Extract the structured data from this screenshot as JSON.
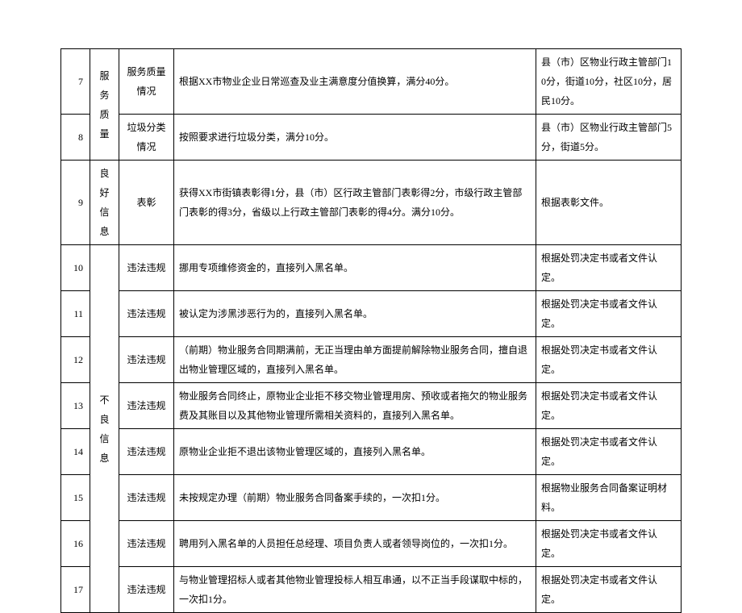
{
  "rows": [
    {
      "idx": "7",
      "cat": "服务质量",
      "item_l1": "服务质量",
      "item_l2": "情况",
      "desc": "根据XX市物业企业日常巡查及业主满意度分值换算，满分40分。",
      "note": "县（市）区物业行政主管部门10分，街道10分，社区10分，居民10分。"
    },
    {
      "idx": "8",
      "cat": "",
      "item_l1": "垃圾分类",
      "item_l2": "情况",
      "desc": "按照要求进行垃圾分类，满分10分。",
      "note": "县（市）区物业行政主管部门5分，街道5分。"
    },
    {
      "idx": "9",
      "cat": "良好信息",
      "item_l1": "表彰",
      "item_l2": "",
      "desc": "获得XX市街镇表彰得1分，县（市）区行政主管部门表彰得2分，市级行政主管部门表彰的得3分，省级以上行政主管部门表彰的得4分。满分10分。",
      "note": "根据表彰文件。"
    },
    {
      "idx": "10",
      "cat": "不良信息",
      "item_l1": "违法违规",
      "item_l2": "",
      "desc": "挪用专项维修资金的，直接列入黑名单。",
      "note": "根据处罚决定书或者文件认定。"
    },
    {
      "idx": "11",
      "cat": "",
      "item_l1": "违法违规",
      "item_l2": "",
      "desc": "被认定为涉黑涉恶行为的，直接列入黑名单。",
      "note": "根据处罚决定书或者文件认定。"
    },
    {
      "idx": "12",
      "cat": "",
      "item_l1": "违法违规",
      "item_l2": "",
      "desc": "（前期）物业服务合同期满前，无正当理由单方面提前解除物业服务合同，擅自退出物业管理区域的，直接列入黑名单。",
      "note": "根据处罚决定书或者文件认定。"
    },
    {
      "idx": "13",
      "cat": "",
      "item_l1": "违法违规",
      "item_l2": "",
      "desc": "物业服务合同终止，原物业企业拒不移交物业管理用房、预收或者拖欠的物业服务费及其账目以及其他物业管理所需相关资料的，直接列入黑名单。",
      "note": "根据处罚决定书或者文件认定。"
    },
    {
      "idx": "14",
      "cat": "",
      "item_l1": "违法违规",
      "item_l2": "",
      "desc": "原物业企业拒不退出该物业管理区域的，直接列入黑名单。",
      "note": "根据处罚决定书或者文件认定。"
    },
    {
      "idx": "15",
      "cat": "",
      "item_l1": "违法违规",
      "item_l2": "",
      "desc": "未按规定办理（前期）物业服务合同备案手续的，一次扣1分。",
      "note": "根据物业服务合同备案证明材料。"
    },
    {
      "idx": "16",
      "cat": "",
      "item_l1": "违法违规",
      "item_l2": "",
      "desc": "聘用列入黑名单的人员担任总经理、项目负责人或者领导岗位的，一次扣1分。",
      "note": "根据处罚决定书或者文件认定。"
    },
    {
      "idx": "17",
      "cat": "",
      "item_l1": "违法违规",
      "item_l2": "",
      "desc": "与物业管理招标人或者其他物业管理投标人相互串通，以不正当手段谋取中标的，一次扣1分。",
      "note": "根据处罚决定书或者文件认定。"
    }
  ]
}
